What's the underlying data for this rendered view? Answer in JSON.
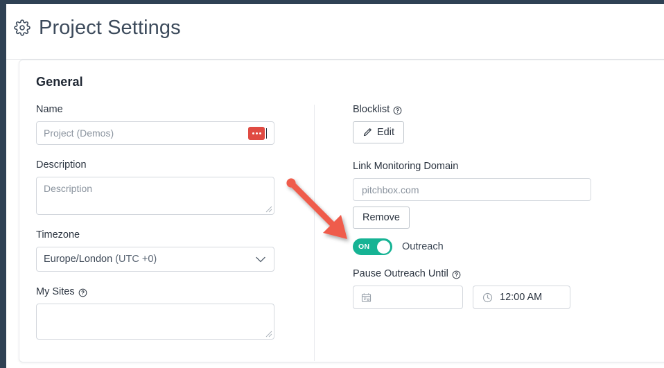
{
  "header": {
    "title": "Project Settings",
    "gear_icon": "gear-icon"
  },
  "card": {
    "section_title": "General"
  },
  "left_column": {
    "name": {
      "label": "Name",
      "value": "Project (Demos)",
      "badge_icon": "ellipsis-badge"
    },
    "description": {
      "label": "Description",
      "placeholder": "Description",
      "value": ""
    },
    "timezone": {
      "label": "Timezone",
      "value_main": "Europe/London",
      "value_offset": "(UTC +0)",
      "chevron_icon": "chevron-down-icon"
    },
    "my_sites": {
      "label": "My Sites",
      "help_icon": "help-circle-icon",
      "value": ""
    }
  },
  "right_column": {
    "blocklist": {
      "label": "Blocklist",
      "help_icon": "help-circle-icon",
      "edit_button": "Edit",
      "edit_icon": "pencil-icon"
    },
    "link_monitoring_domain": {
      "label": "Link Monitoring Domain",
      "value": "pitchbox.com"
    },
    "remove_button": "Remove",
    "outreach_toggle": {
      "state_text": "ON",
      "label": "Outreach",
      "color": "#16b394",
      "enabled": true
    },
    "pause_outreach": {
      "label": "Pause Outreach Until",
      "help_icon": "help-circle-icon",
      "date_value": "",
      "date_icon": "calendar-icon",
      "time_value": "12:00 AM",
      "time_icon": "clock-icon"
    }
  },
  "annotation": {
    "arrow_icon": "red-arrow-pointer",
    "color": "#ef5b4c"
  }
}
